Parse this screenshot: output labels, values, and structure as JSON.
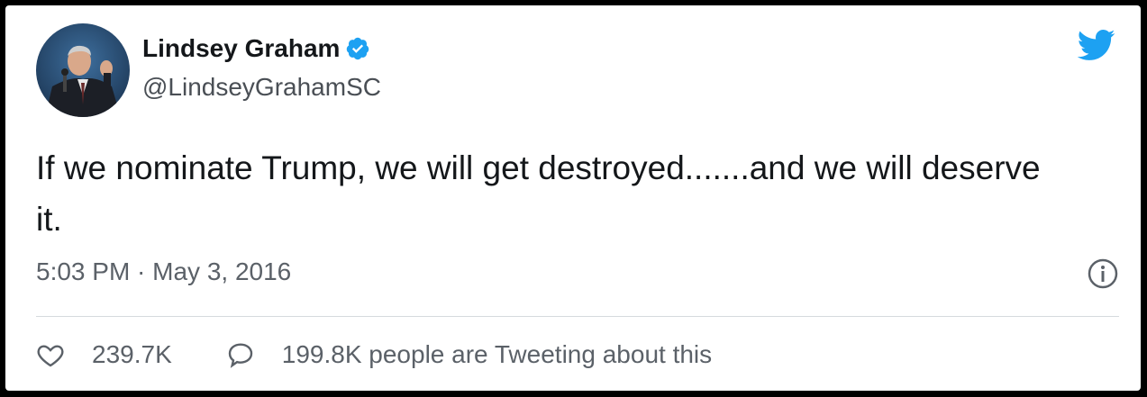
{
  "author": {
    "name": "Lindsey Graham",
    "handle": "@LindseyGrahamSC",
    "verified": true
  },
  "tweet": {
    "text": "If we nominate Trump, we will get destroyed.......and we will deserve it.",
    "timestamp": "5:03 PM · May 3, 2016"
  },
  "stats": {
    "likes": "239.7K",
    "tweeting_about": "199.8K people are Tweeting about this"
  },
  "icons": {
    "brand": "twitter-bird-icon",
    "verified": "verified-badge-icon",
    "info": "info-icon",
    "like": "heart-icon",
    "reply": "speech-bubble-icon"
  },
  "colors": {
    "brand": "#1da1f2",
    "text": "#14171a",
    "secondary": "#5b6168"
  }
}
